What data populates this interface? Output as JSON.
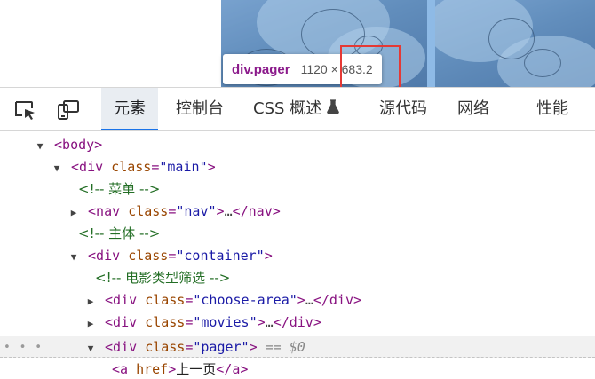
{
  "tooltip": {
    "tag": "div.pager",
    "dimensions": "1120 × 683.2"
  },
  "toolbar": {
    "tabs": [
      {
        "label": "元素",
        "active": true
      },
      {
        "label": "控制台"
      },
      {
        "label": "CSS 概述"
      },
      {
        "label": "源代码"
      },
      {
        "label": "网络"
      },
      {
        "label": "性能"
      }
    ],
    "icons": [
      "inspect-element-icon",
      "device-toolbar-icon",
      "flask-icon"
    ]
  },
  "dom_tree": {
    "body_tag": "<body>",
    "main_open": "<div",
    "main_attr": "class",
    "main_value": "\"main\"",
    "comment_menu": "<!-- 菜单 -->",
    "nav_open": "<nav",
    "nav_attr": "class",
    "nav_value": "\"nav\"",
    "nav_close": "</nav>",
    "comment_main": "<!-- 主体 -->",
    "container_open": "<div",
    "container_attr": "class",
    "container_value": "\"container\"",
    "comment_filter": "<!-- 电影类型筛选 -->",
    "choose_open": "<div",
    "choose_attr": "class",
    "choose_value": "\"choose-area\"",
    "choose_close": "</div>",
    "movies_open": "<div",
    "movies_attr": "class",
    "movies_value": "\"movies\"",
    "movies_close": "</div>",
    "pager_open": "<div",
    "pager_attr": "class",
    "pager_value": "\"pager\"",
    "selected_marker": "== $0",
    "link_open": "<a",
    "link_attr": "href",
    "link_text": "上一页",
    "link_close": "</a>",
    "ellipsis": "…",
    "gt": ">",
    "gap_dots": "• • •"
  },
  "colors": {
    "tag": "#881280",
    "attr_name": "#994500",
    "attr_value": "#1a1aa6",
    "comment": "#236e25",
    "highlight_box": "#e53935",
    "active_tab_underline": "#1a73e8"
  }
}
